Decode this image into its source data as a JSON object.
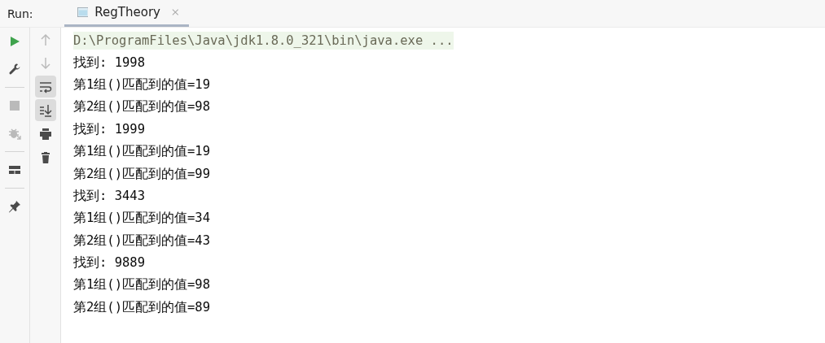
{
  "run_bar": {
    "label": "Run:",
    "tabs": [
      {
        "title": "RegTheory",
        "selected": true
      }
    ]
  },
  "toolbar_left": [
    {
      "kind": "run",
      "disabled": false
    },
    {
      "kind": "wrench",
      "disabled": false
    },
    {
      "kind": "divider"
    },
    {
      "kind": "stop",
      "disabled": true
    },
    {
      "kind": "debug",
      "disabled": true
    },
    {
      "kind": "divider"
    },
    {
      "kind": "layout",
      "disabled": false
    },
    {
      "kind": "divider"
    },
    {
      "kind": "pin",
      "disabled": false
    }
  ],
  "toolbar_right": [
    {
      "kind": "up",
      "disabled": true,
      "on": false
    },
    {
      "kind": "down",
      "disabled": true,
      "on": false
    },
    {
      "kind": "wrap",
      "disabled": false,
      "on": true
    },
    {
      "kind": "scroll_end",
      "disabled": false,
      "on": true
    },
    {
      "kind": "print",
      "disabled": false,
      "on": false
    },
    {
      "kind": "trash",
      "disabled": false,
      "on": false
    }
  ],
  "console": {
    "lines": [
      {
        "kind": "command",
        "text": "D:\\ProgramFiles\\Java\\jdk1.8.0_321\\bin\\java.exe ..."
      },
      {
        "kind": "output",
        "text": "找到: 1998"
      },
      {
        "kind": "output",
        "text": "第1组()匹配到的值=19"
      },
      {
        "kind": "output",
        "text": "第2组()匹配到的值=98"
      },
      {
        "kind": "output",
        "text": "找到: 1999"
      },
      {
        "kind": "output",
        "text": "第1组()匹配到的值=19"
      },
      {
        "kind": "output",
        "text": "第2组()匹配到的值=99"
      },
      {
        "kind": "output",
        "text": "找到: 3443"
      },
      {
        "kind": "output",
        "text": "第1组()匹配到的值=34"
      },
      {
        "kind": "output",
        "text": "第2组()匹配到的值=43"
      },
      {
        "kind": "output",
        "text": "找到: 9889"
      },
      {
        "kind": "output",
        "text": "第1组()匹配到的值=98"
      },
      {
        "kind": "output",
        "text": "第2组()匹配到的值=89"
      }
    ]
  }
}
